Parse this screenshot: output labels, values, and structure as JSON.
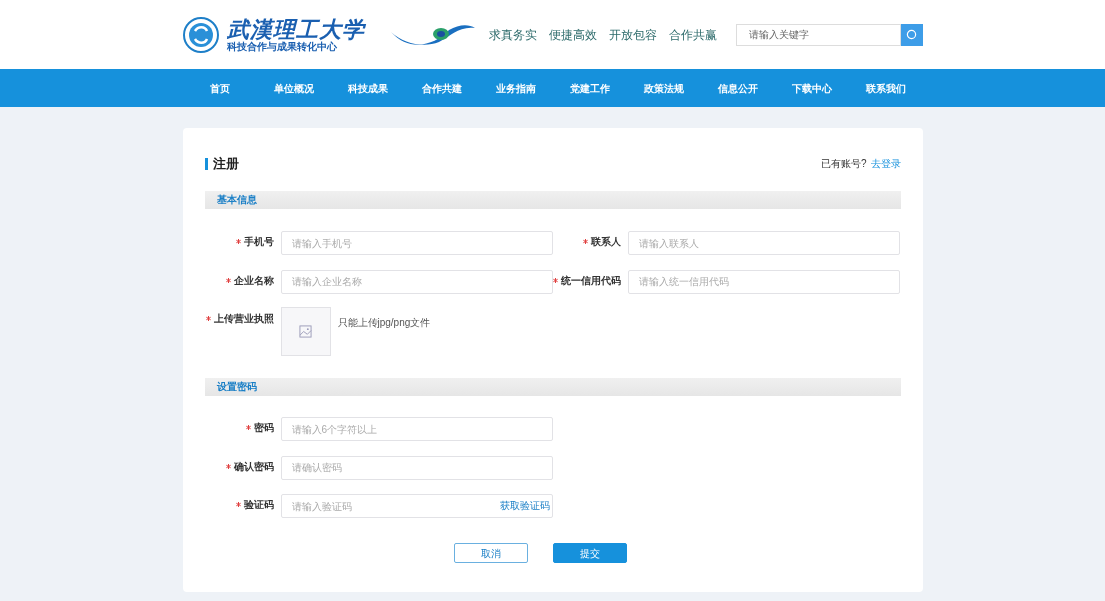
{
  "header": {
    "logo": {
      "title": "武漢理工大学",
      "subtitle": "科技合作与成果转化中心"
    },
    "slogans": [
      "求真务实",
      "便捷高效",
      "开放包容",
      "合作共赢"
    ],
    "search": {
      "placeholder": "请输入关键字"
    }
  },
  "nav": [
    {
      "label": "首页"
    },
    {
      "label": "单位概况"
    },
    {
      "label": "科技成果"
    },
    {
      "label": "合作共建"
    },
    {
      "label": "业务指南"
    },
    {
      "label": "党建工作"
    },
    {
      "label": "政策法规"
    },
    {
      "label": "信息公开"
    },
    {
      "label": "下载中心"
    },
    {
      "label": "联系我们"
    }
  ],
  "form": {
    "title": "注册",
    "login_prompt": "已有账号?",
    "login_link": "去登录",
    "sections": [
      {
        "title": "基本信息",
        "rows": [
          [
            {
              "kind": "text",
              "label": "手机号",
              "required": true,
              "placeholder": "请输入手机号"
            },
            {
              "kind": "text",
              "label": "联系人",
              "required": true,
              "placeholder": "请输入联系人"
            }
          ],
          [
            {
              "kind": "text",
              "label": "企业名称",
              "required": true,
              "placeholder": "请输入企业名称"
            },
            {
              "kind": "text",
              "label": "统一信用代码",
              "required": true,
              "placeholder": "请输入统一信用代码"
            }
          ],
          [
            {
              "kind": "upload",
              "label": "上传营业执照",
              "required": true,
              "hint": "只能上传jpg/png文件"
            }
          ]
        ]
      },
      {
        "title": "设置密码",
        "rows": [
          [
            {
              "kind": "text",
              "label": "密码",
              "required": true,
              "placeholder": "请输入6个字符以上"
            }
          ],
          [
            {
              "kind": "text",
              "label": "确认密码",
              "required": true,
              "placeholder": "请确认密码"
            }
          ],
          [
            {
              "kind": "code",
              "label": "验证码",
              "required": true,
              "placeholder": "请输入验证码",
              "action": "获取验证码"
            }
          ]
        ]
      }
    ],
    "buttons": [
      {
        "label": "取消",
        "kind": "secondary"
      },
      {
        "label": "提交",
        "kind": "primary"
      }
    ]
  }
}
